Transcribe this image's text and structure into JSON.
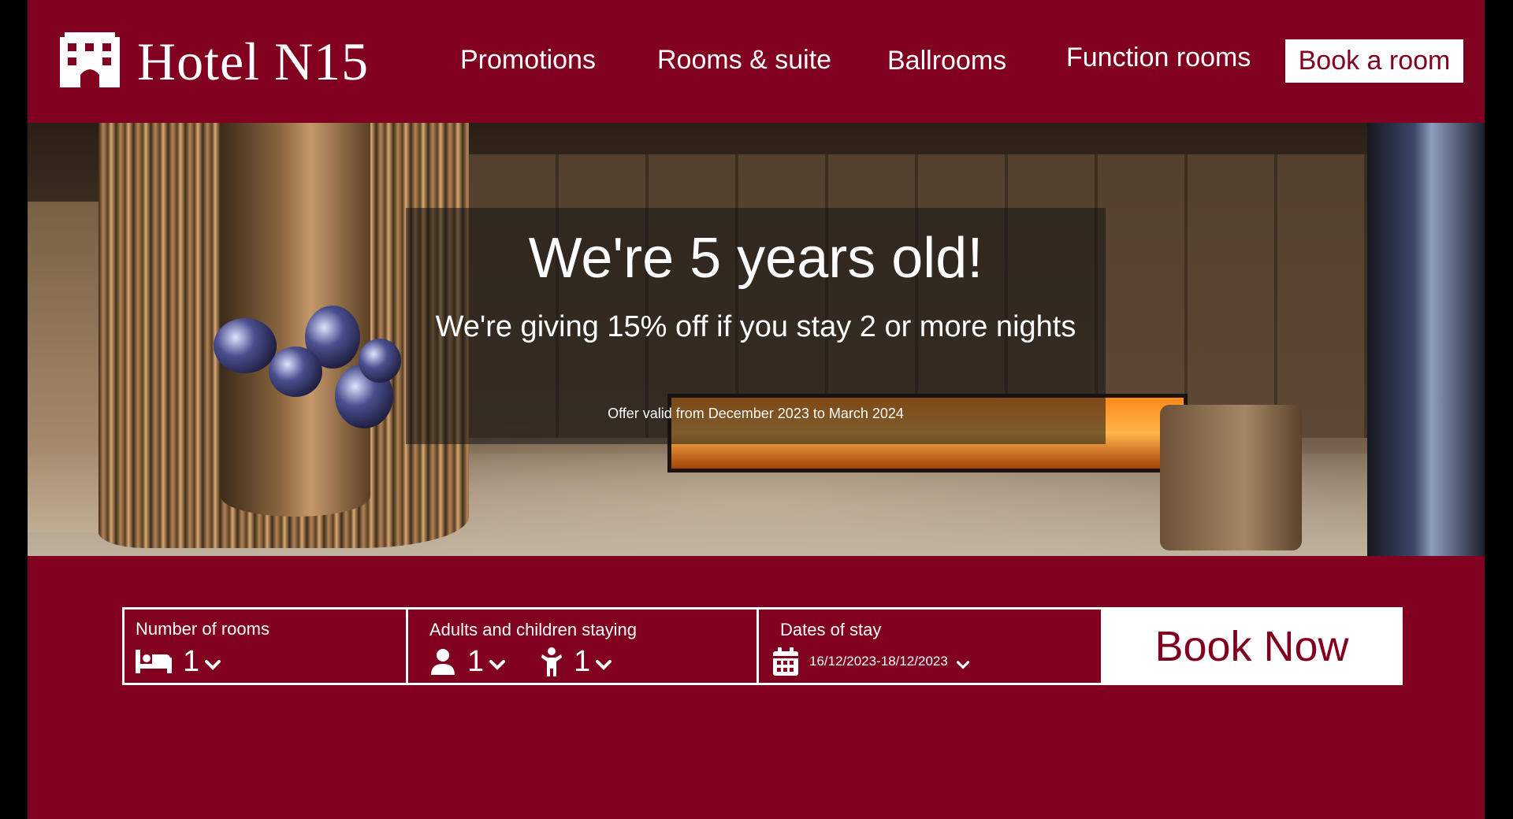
{
  "brand": {
    "name": "Hotel N15",
    "icon": "hotel-building-icon",
    "color": "#82001f"
  },
  "nav": {
    "items": [
      {
        "label": "Promotions"
      },
      {
        "label": "Rooms & suite"
      },
      {
        "label": "Ballrooms"
      },
      {
        "label": "Function rooms"
      }
    ],
    "cta_label": "Book a room"
  },
  "hero": {
    "title": "We're 5 years old!",
    "subtitle": "We're giving 15% off if you stay 2 or more nights",
    "validity": "Offer valid from December 2023 to March 2024"
  },
  "booking": {
    "rooms": {
      "label": "Number of rooms",
      "value": "1",
      "icon": "bed-icon"
    },
    "guests": {
      "label": "Adults and children staying",
      "adults": "1",
      "adults_icon": "adult-person-icon",
      "children": "1",
      "children_icon": "child-person-icon"
    },
    "dates": {
      "label": "Dates of stay",
      "value": "16/12/2023-18/12/2023",
      "icon": "calendar-icon"
    },
    "submit_label": "Book Now"
  }
}
